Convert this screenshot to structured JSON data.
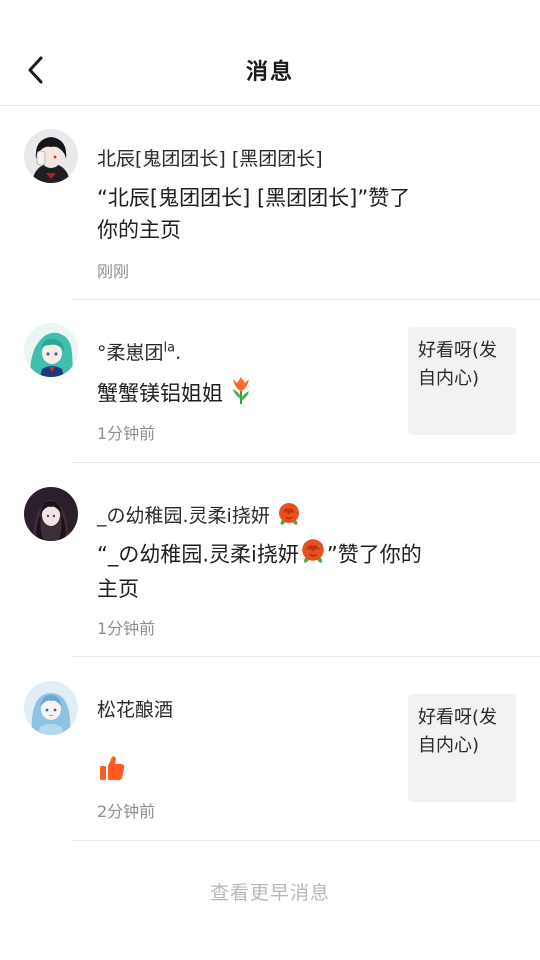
{
  "header": {
    "title": "消息"
  },
  "messages": [
    {
      "sender": "北辰[鬼团团长] [黑团团长]",
      "content": "“北辰[鬼团团长] [黑团团长]”赞了你的主页",
      "content_line1": "“北辰[鬼团团长] [黑团团长]”赞了",
      "content_line2": "你的主页",
      "time": "刚刚"
    },
    {
      "sender": "°柔崽团",
      "sender_suffix": "la",
      "sender_dot": ".",
      "content": "蟹蟹镁铝姐姐",
      "content_emoji": "tulip-icon",
      "time": "1分钟前",
      "quote": "好看呀(发自内心)"
    },
    {
      "sender": "_の幼稚园.灵柔i挠妍",
      "sender_emoji": "rose-icon",
      "content_line1": "“_の幼稚园.灵柔i挠妍",
      "content_line1_tail": "”赞了你的",
      "content_line2": "主页",
      "time": "1分钟前"
    },
    {
      "sender": "松花酿酒",
      "content_emoji": "thumbs-up-icon",
      "time": "2分钟前",
      "quote": "好看呀(发自内心)"
    }
  ],
  "footer": {
    "more_label": "查看更早消息"
  },
  "colors": {
    "accent_orange": "#ff5a1f",
    "divider": "#e8e8e8",
    "muted_text": "#8f8f8f",
    "quote_bg": "#f2f2f2"
  }
}
